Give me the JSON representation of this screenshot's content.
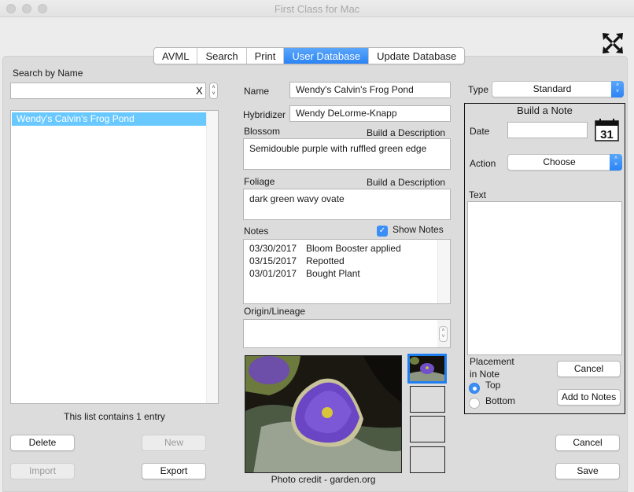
{
  "window": {
    "title": "First Class for Mac"
  },
  "tabs": [
    {
      "label": "AVML",
      "active": false
    },
    {
      "label": "Search",
      "active": false
    },
    {
      "label": "Print",
      "active": false
    },
    {
      "label": "User Database",
      "active": true
    },
    {
      "label": "Update Database",
      "active": false
    }
  ],
  "search": {
    "label": "Search by Name",
    "value": "",
    "placeholder": "",
    "clear_label": "X"
  },
  "name_list": {
    "items": [
      "Wendy's Calvin's Frog Pond"
    ],
    "selected_index": 0,
    "count_text": "This list contains 1 entry"
  },
  "list_buttons": {
    "delete": "Delete",
    "new": "New",
    "import": "Import",
    "export": "Export"
  },
  "record": {
    "name_label": "Name",
    "name_value": "Wendy's Calvin's Frog Pond",
    "hybridizer_label": "Hybridizer",
    "hybridizer_value": "Wendy DeLorme-Knapp",
    "blossom_label": "Blossom",
    "blossom_build": "Build a Description",
    "blossom_value": "Semidouble purple with ruffled green edge",
    "foliage_label": "Foliage",
    "foliage_build": "Build a Description",
    "foliage_value": "dark green wavy ovate",
    "notes_label": "Notes",
    "show_notes_label": "Show Notes",
    "show_notes_checked": true,
    "notes": [
      {
        "date": "03/30/2017",
        "text": "Bloom Booster applied"
      },
      {
        "date": "03/15/2017",
        "text": "Repotted"
      },
      {
        "date": "03/01/2017",
        "text": "Bought Plant"
      }
    ],
    "origin_label": "Origin/Lineage",
    "origin_value": "",
    "photo_credit": "Photo credit - garden.org"
  },
  "type": {
    "label": "Type",
    "value": "Standard"
  },
  "build_note": {
    "title": "Build a Note",
    "date_label": "Date",
    "date_value": "",
    "calendar_day": "31",
    "action_label": "Action",
    "action_value": "Choose",
    "text_label": "Text",
    "text_value": "",
    "placement_label_1": "Placement",
    "placement_label_2": "in Note",
    "placement_options": [
      {
        "label": "Top",
        "selected": true
      },
      {
        "label": "Bottom",
        "selected": false
      }
    ],
    "cancel": "Cancel",
    "add": "Add to Notes"
  },
  "footer_buttons": {
    "cancel": "Cancel",
    "save": "Save"
  },
  "colors": {
    "accent": "#2b84f4",
    "selection": "#69c9ff"
  }
}
